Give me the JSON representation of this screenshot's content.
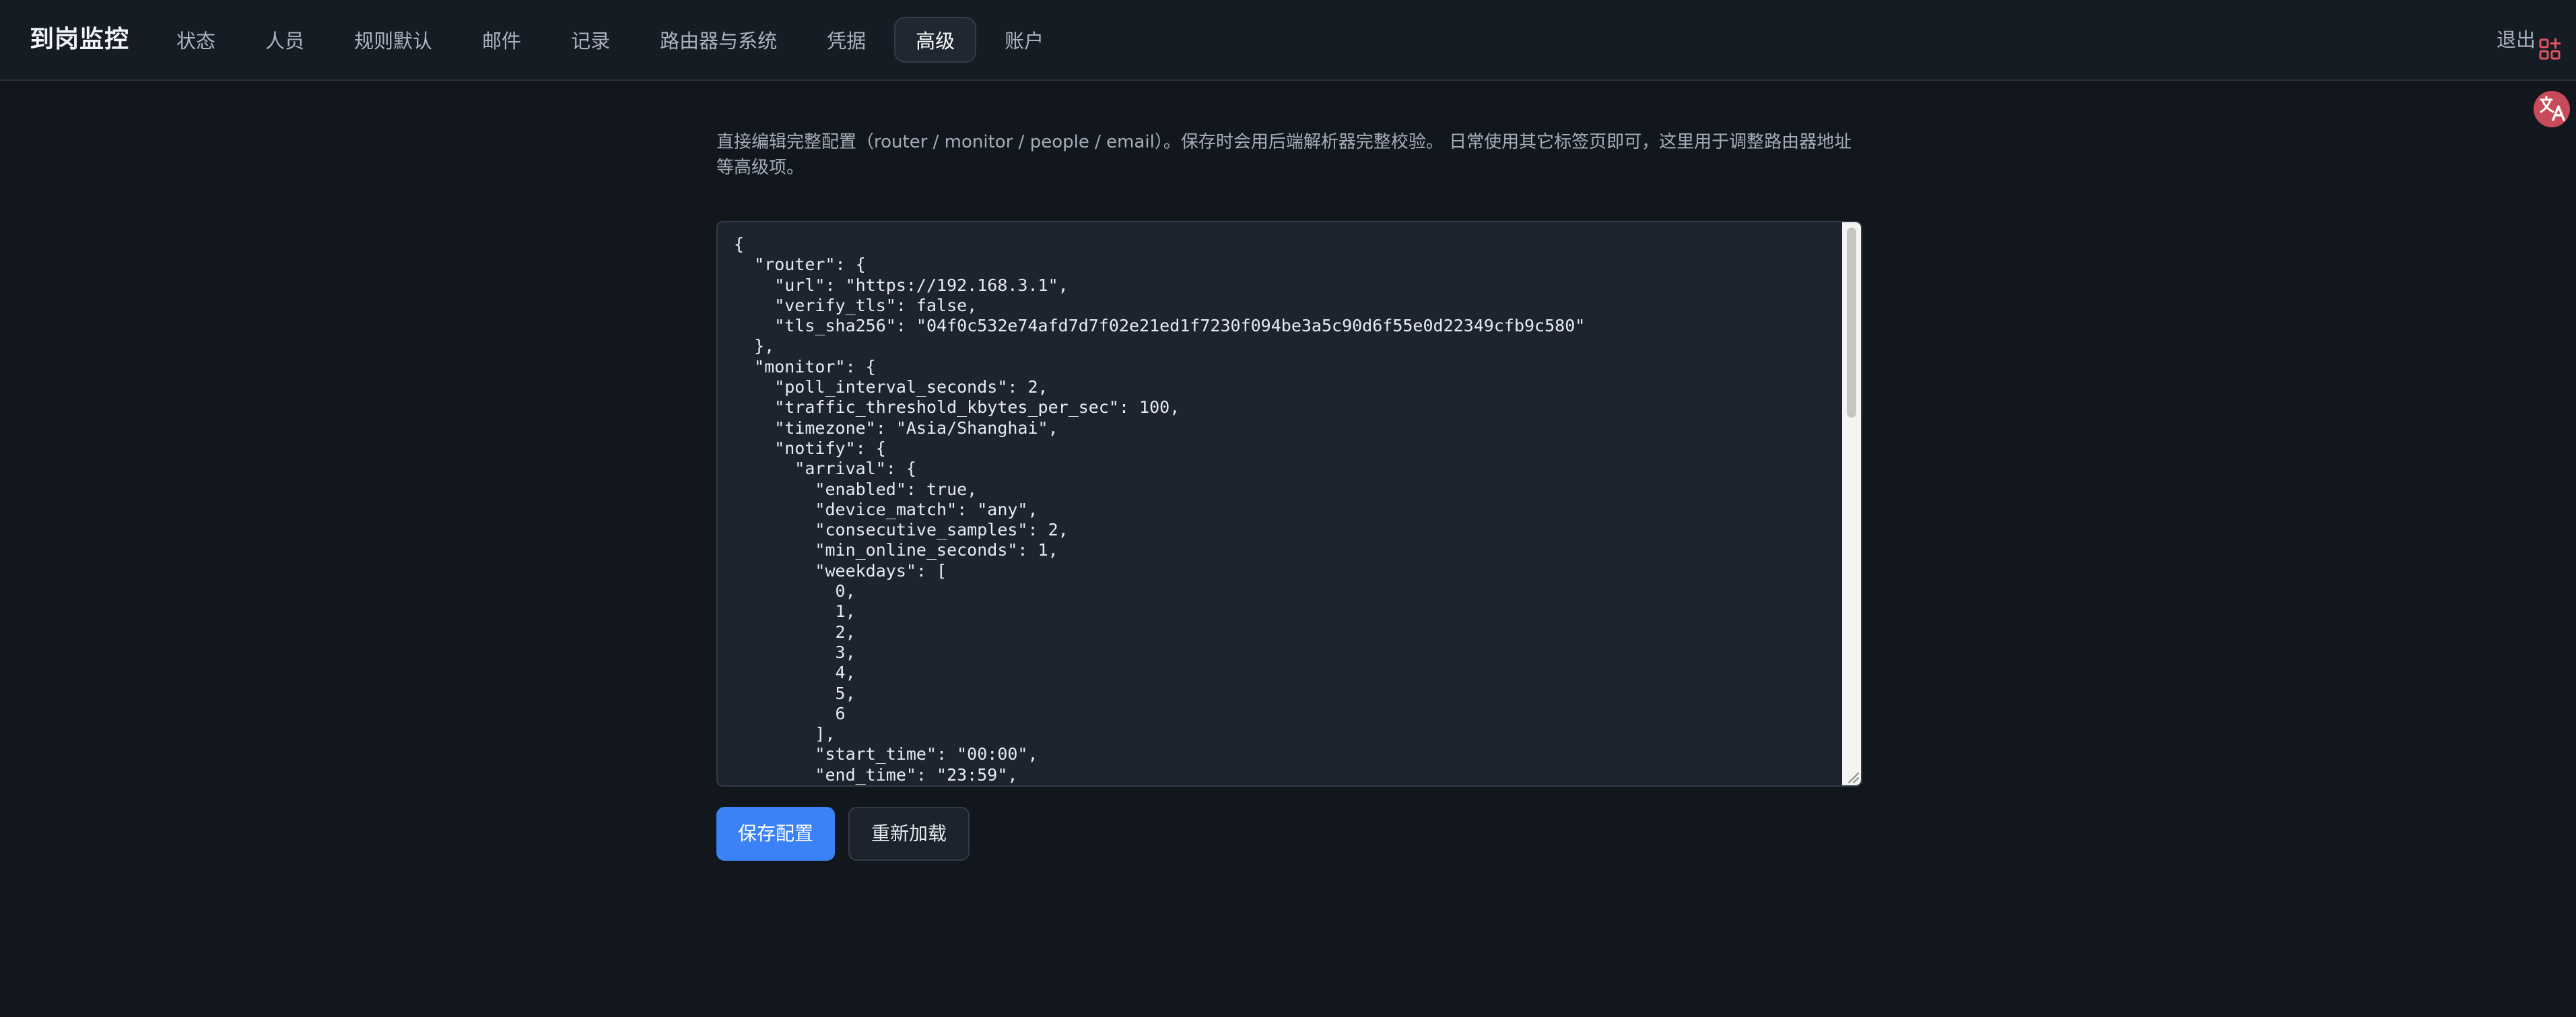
{
  "app": {
    "brand": "到岗监控",
    "logout_label": "退出"
  },
  "nav": {
    "tabs": [
      {
        "label": "状态"
      },
      {
        "label": "人员"
      },
      {
        "label": "规则默认"
      },
      {
        "label": "邮件"
      },
      {
        "label": "记录"
      },
      {
        "label": "路由器与系统"
      },
      {
        "label": "凭据"
      },
      {
        "label": "高级",
        "active": true
      },
      {
        "label": "账户"
      }
    ]
  },
  "advanced": {
    "description": "直接编辑完整配置（router / monitor / people / email）。保存时会用后端解析器完整校验。 日常使用其它标签页即可，这里用于调整路由器地址等高级项。",
    "config_text": "{\n  \"router\": {\n    \"url\": \"https://192.168.3.1\",\n    \"verify_tls\": false,\n    \"tls_sha256\": \"04f0c532e74afd7d7f02e21ed1f7230f094be3a5c90d6f55e0d22349cfb9c580\"\n  },\n  \"monitor\": {\n    \"poll_interval_seconds\": 2,\n    \"traffic_threshold_kbytes_per_sec\": 100,\n    \"timezone\": \"Asia/Shanghai\",\n    \"notify\": {\n      \"arrival\": {\n        \"enabled\": true,\n        \"device_match\": \"any\",\n        \"consecutive_samples\": 2,\n        \"min_online_seconds\": 1,\n        \"weekdays\": [\n          0,\n          1,\n          2,\n          3,\n          4,\n          5,\n          6\n        ],\n        \"start_time\": \"00:00\",\n        \"end_time\": \"23:59\",",
    "save_label": "保存配置",
    "reload_label": "重新加载"
  },
  "colors": {
    "background": "#12171e",
    "topbar": "#161c24",
    "editor_bg": "#1c252f",
    "primary": "#3b82f6",
    "badge_red": "#e05561"
  },
  "icons": {
    "apps": "apps-grid-add-icon",
    "translate": "translate-icon"
  }
}
